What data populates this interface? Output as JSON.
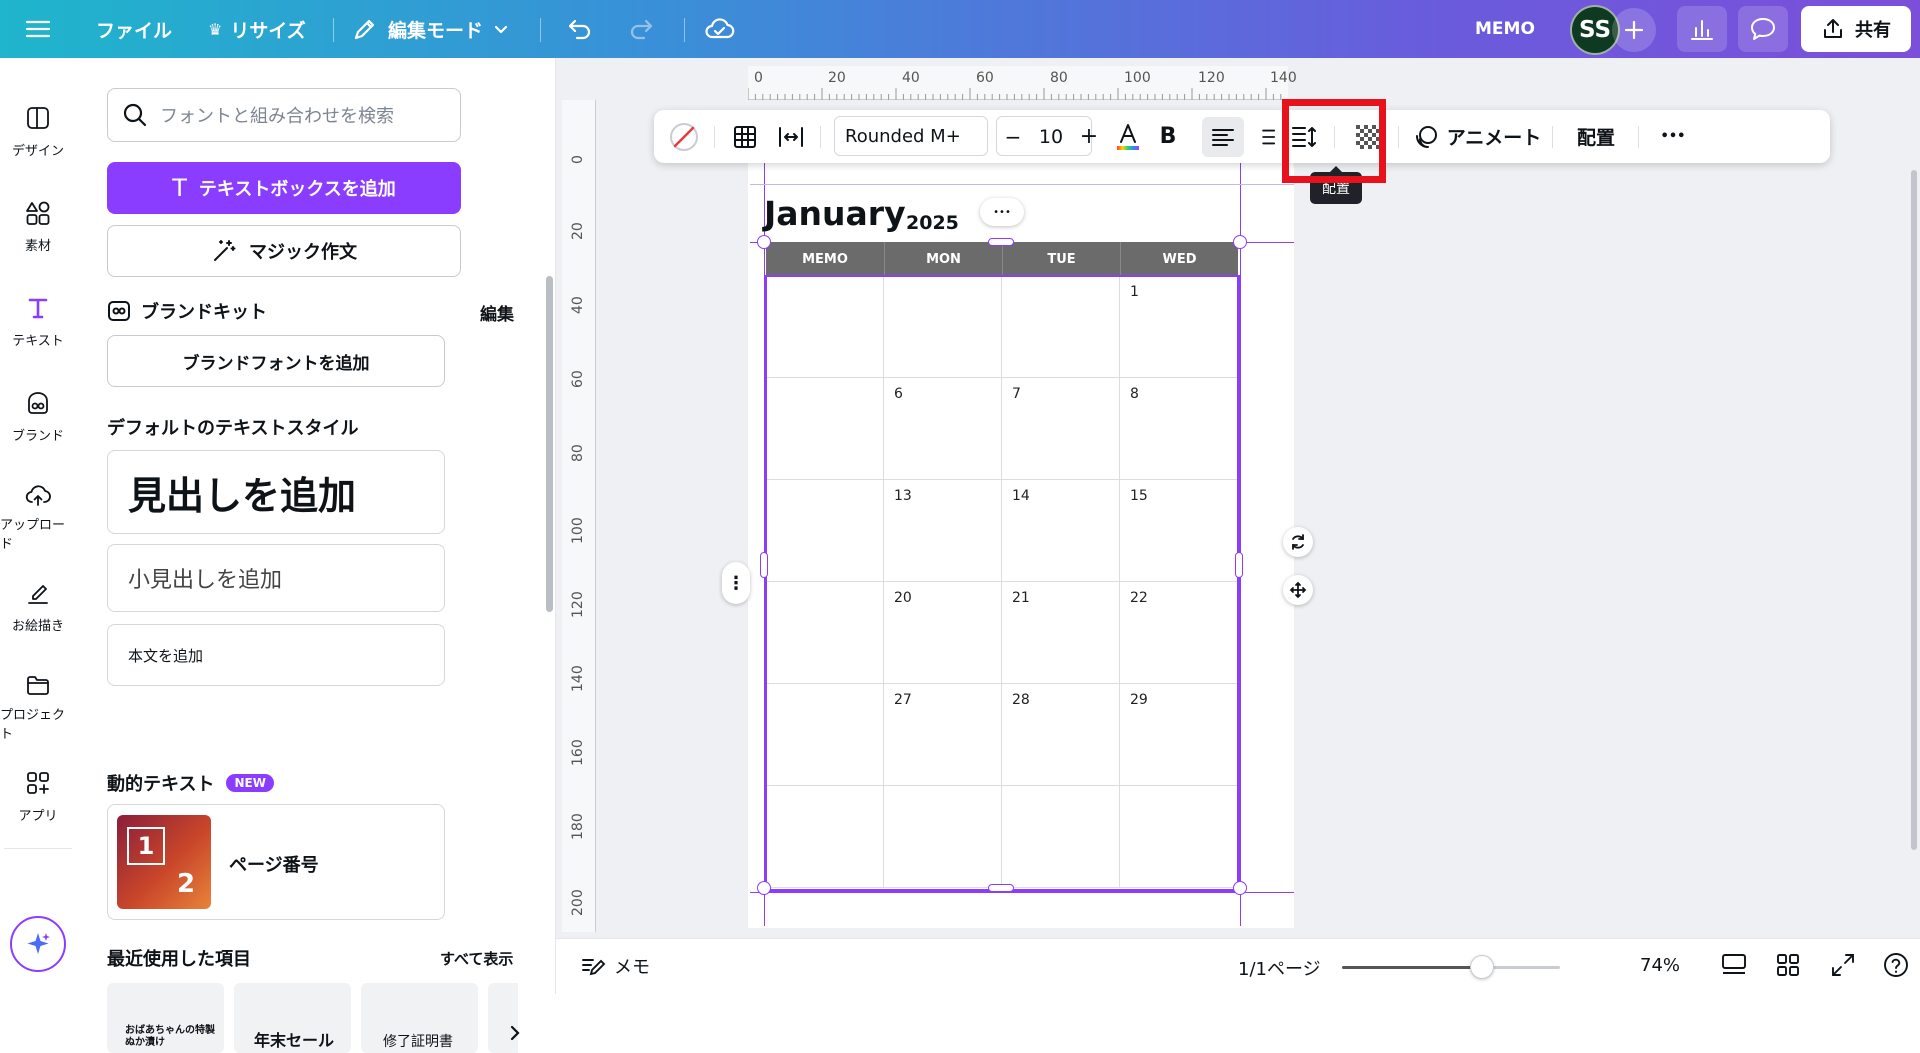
{
  "topbar": {
    "file": "ファイル",
    "resize": "リサイズ",
    "edit_mode": "編集モード",
    "memo": "MEMO",
    "avatar": "SS",
    "share": "共有"
  },
  "rail": {
    "items": [
      {
        "label": "デザイン"
      },
      {
        "label": "素材"
      },
      {
        "label": "テキスト"
      },
      {
        "label": "ブランド"
      },
      {
        "label": "アップロード"
      },
      {
        "label": "お絵描き"
      },
      {
        "label": "プロジェクト"
      },
      {
        "label": "アプリ"
      }
    ]
  },
  "panel": {
    "search_placeholder": "フォントと組み合わせを検索",
    "add_textbox": "テキストボックスを追加",
    "magic_write": "マジック作文",
    "brand_kit": "ブランドキット",
    "brand_edit": "編集",
    "add_brand_font": "ブランドフォントを追加",
    "default_styles": "デフォルトのテキストスタイル",
    "heading": "見出しを追加",
    "subheading": "小見出しを追加",
    "body": "本文を追加",
    "dynamic_text": "動的テキスト",
    "new_badge": "NEW",
    "page_number": "ページ番号",
    "page_number_thumb_1": "1",
    "page_number_thumb_2": "2",
    "recent": "最近使用した項目",
    "see_all": "すべて表示",
    "recent_items": [
      "おばあちゃんの特製ぬか漬け",
      "年末セール",
      "修了証明書"
    ]
  },
  "toolbar": {
    "font": "Rounded M+",
    "size": "10",
    "minus": "−",
    "plus": "+",
    "bold": "B",
    "animate": "アニメート",
    "position": "配置",
    "tooltip": "配置",
    "more": "•••"
  },
  "ruler_top": [
    "0",
    "20",
    "40",
    "60",
    "80",
    "100",
    "120",
    "140"
  ],
  "ruler_left": [
    "0",
    "20",
    "40",
    "60",
    "80",
    "100",
    "120",
    "140",
    "160",
    "180",
    "200"
  ],
  "calendar": {
    "month": "January",
    "year": "2025",
    "element_menu": "•••",
    "headers": [
      "MEMO",
      "MON",
      "TUE",
      "WED"
    ],
    "rows": [
      [
        "",
        "",
        "",
        "1"
      ],
      [
        "",
        "6",
        "7",
        "8"
      ],
      [
        "",
        "13",
        "14",
        "15"
      ],
      [
        "",
        "20",
        "21",
        "22"
      ],
      [
        "",
        "27",
        "28",
        "29"
      ],
      [
        "",
        "",
        "",
        ""
      ]
    ]
  },
  "bottom": {
    "notes": "メモ",
    "pages": "1/1ページ",
    "zoom": "74%",
    "zoom_level": 0.74
  },
  "colors": {
    "accent": "#8b3dff",
    "highlight": "#e8121c",
    "table_header": "#6b6b6b"
  }
}
